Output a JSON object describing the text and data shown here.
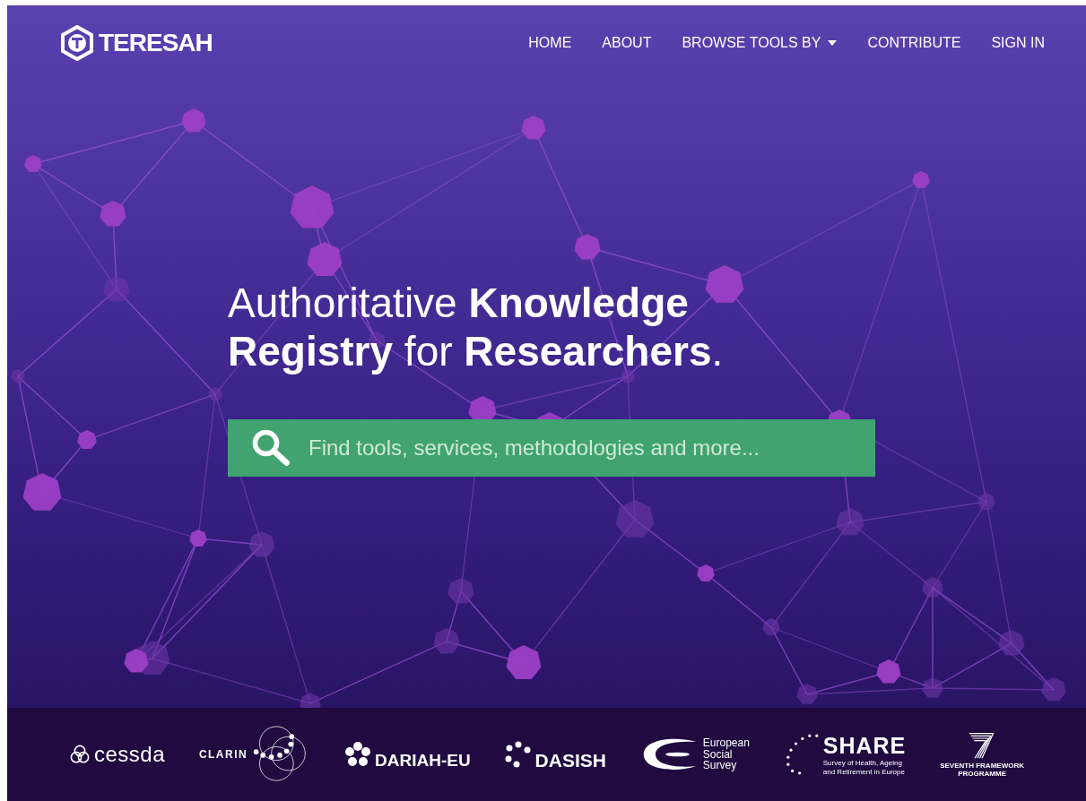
{
  "logo": {
    "name": "TERESAH"
  },
  "nav": [
    {
      "label": "HOME",
      "kind": "link"
    },
    {
      "label": "ABOUT",
      "kind": "link"
    },
    {
      "label": "BROWSE TOOLS BY",
      "kind": "dropdown"
    },
    {
      "label": "CONTRIBUTE",
      "kind": "link"
    },
    {
      "label": "SIGN IN",
      "kind": "link"
    }
  ],
  "headline": "Authoritative **Knowledge** **Registry** for **Researchers**.",
  "search": {
    "placeholder": "Find tools, services, methodologies and more..."
  },
  "partners": [
    {
      "kind": "cessda",
      "lines": [
        "cessda"
      ]
    },
    {
      "kind": "clarin",
      "lines": [
        "CLARIN"
      ]
    },
    {
      "kind": "dariah",
      "lines": [
        "DARIAH-EU"
      ]
    },
    {
      "kind": "dasish",
      "lines": [
        "DASISH"
      ]
    },
    {
      "kind": "ess",
      "lines": [
        "European",
        "Social",
        "Survey"
      ]
    },
    {
      "kind": "share",
      "lines": [
        "SHARE"
      ],
      "subtitle": [
        "Survey of Health, Ageing",
        "and Retirement in Europe"
      ]
    },
    {
      "kind": "fp7",
      "lines": [
        "SEVENTH FRAMEWORK",
        "PROGRAMME"
      ]
    }
  ]
}
